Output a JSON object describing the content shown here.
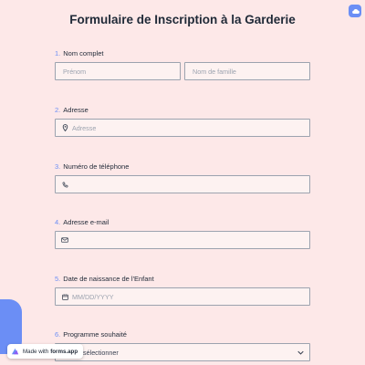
{
  "form": {
    "title": "Formulaire de Inscription à la Garderie"
  },
  "questions": [
    {
      "number": "1.",
      "label": "Nom complet"
    },
    {
      "number": "2.",
      "label": "Adresse"
    },
    {
      "number": "3.",
      "label": "Numéro de téléphone"
    },
    {
      "number": "4.",
      "label": "Adresse e-mail"
    },
    {
      "number": "5.",
      "label": "Date de naissance de l'Enfant"
    },
    {
      "number": "6.",
      "label": "Programme souhaité"
    }
  ],
  "fields": {
    "first_name_placeholder": "Prénom",
    "last_name_placeholder": "Nom de famille",
    "address_placeholder": "Adresse",
    "phone_value": "",
    "email_value": "",
    "dob_placeholder": "MM/DD/YYYY",
    "program_placeholder": "sélectionner"
  },
  "branding": {
    "made_with": "Made with",
    "brand": "forms.app"
  },
  "icons": {
    "address": "map-pin-icon",
    "phone": "phone-icon",
    "email": "mail-icon",
    "date": "calendar-icon",
    "select": "chevron-down-icon",
    "top_right": "cloud-icon"
  },
  "colors": {
    "background": "#fde8e8",
    "accent": "#6b8ef5",
    "field_bg": "#fdf2f1",
    "border": "#9ca3af"
  }
}
